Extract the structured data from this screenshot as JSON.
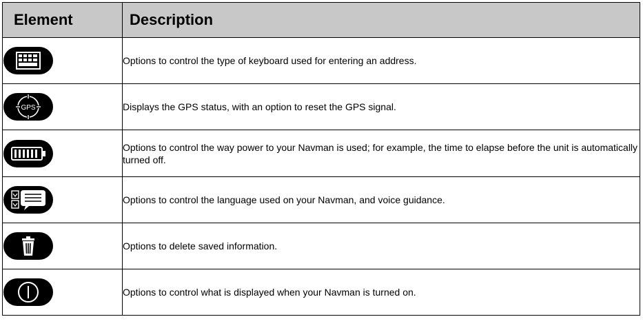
{
  "header": {
    "element": "Element",
    "description": "Description"
  },
  "rows": [
    {
      "icon": "keyboard-icon",
      "description": "Options to control the type of keyboard used for entering an address."
    },
    {
      "icon": "gps-icon",
      "description": "Displays the GPS status, with an option to reset the GPS signal."
    },
    {
      "icon": "battery-icon",
      "description": "Options to control the way power to your Navman is used; for example, the time to elapse before the unit is automatically turned off."
    },
    {
      "icon": "language-icon",
      "description": "Options to control the language used on your Navman, and voice guidance."
    },
    {
      "icon": "trash-icon",
      "description": "Options to delete saved information."
    },
    {
      "icon": "power-icon",
      "description": "Options to control what is displayed when your Navman is turned on."
    }
  ],
  "colors": {
    "header_bg": "#c8c8c8",
    "icon_bg": "#000000",
    "icon_fg": "#ffffff"
  }
}
